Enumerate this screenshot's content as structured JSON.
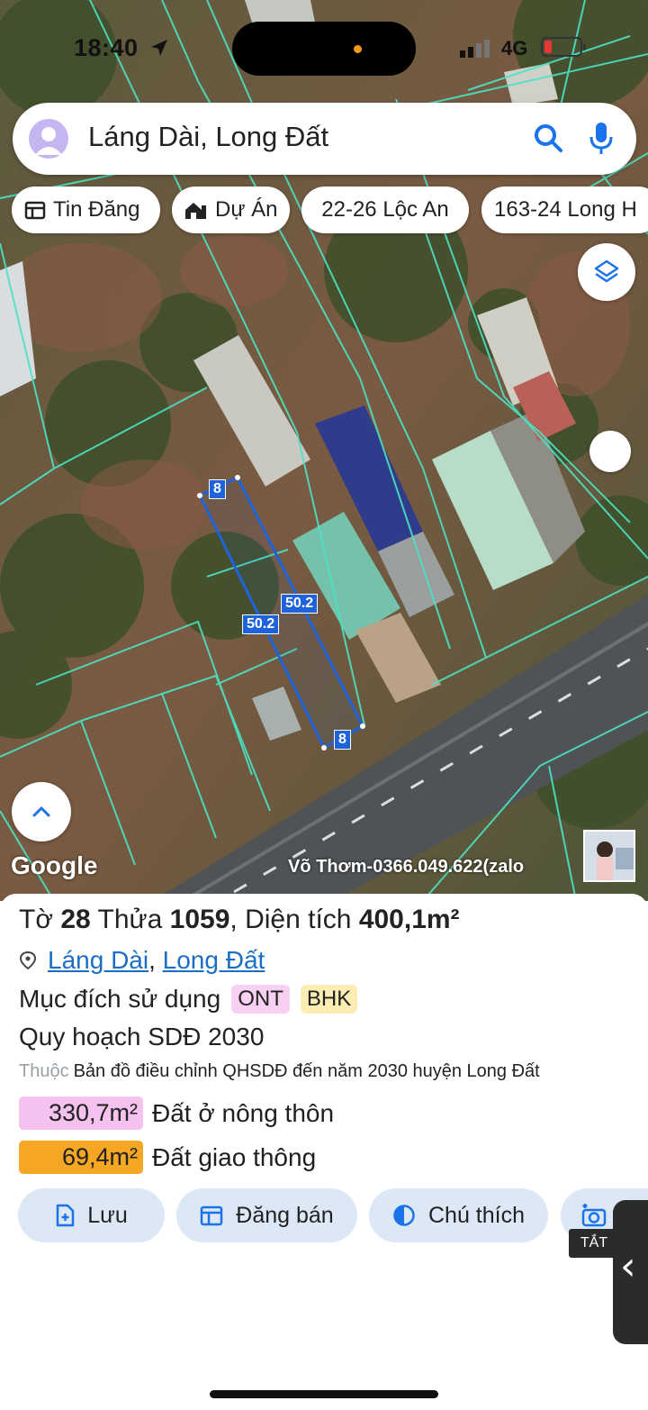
{
  "status_bar": {
    "time": "18:40",
    "network": "4G"
  },
  "search": {
    "query": "Láng Dài, Long Đất"
  },
  "chips": [
    {
      "label": "Tin Đăng",
      "icon": "listing-icon"
    },
    {
      "label": "Dự Án",
      "icon": "home-icon"
    },
    {
      "label": "22-26 Lộc An"
    },
    {
      "label": "163-24 Long H"
    }
  ],
  "map": {
    "attribution": "Google",
    "watermark": "Võ Thơm-0366.049.622(zalo",
    "measurements": {
      "side_a": "50.2",
      "side_b": "50.2",
      "top": "8",
      "bottom": "8"
    },
    "colors": {
      "parcel_outline": "#1e63d9",
      "cadastral_lines": "#4be3c4"
    }
  },
  "parcel": {
    "sheet_label": "Tờ",
    "sheet_number": "28",
    "plot_label": "Thửa",
    "plot_number": "1059",
    "area_label": "Diện tích",
    "area_value": "400,1m²",
    "ward": "Láng Dài",
    "district": "Long Đất",
    "land_use_label": "Mục đích sử dụng",
    "land_use_codes": [
      {
        "code": "ONT",
        "color": "#f7d0f2"
      },
      {
        "code": "BHK",
        "color": "#fbedb4"
      }
    ],
    "plan_title": "Quy hoạch SDĐ 2030",
    "source_label": "Thuộc",
    "source_value": "Bản đồ điều chỉnh QHSDĐ đến năm 2030 huyện Long Đất",
    "zones": [
      {
        "area": "330,7m²",
        "label": "Đất ở nông thôn",
        "color": "#f5c2f0"
      },
      {
        "area": "69,4m²",
        "label": "Đất giao thông",
        "color": "#f5a623"
      }
    ]
  },
  "actions": [
    {
      "label": "Lưu",
      "icon": "save-doc-icon"
    },
    {
      "label": "Đăng bán",
      "icon": "calendar-post-icon"
    },
    {
      "label": "Chú thích",
      "icon": "contrast-icon"
    },
    {
      "label": "",
      "icon": "camera-icon"
    }
  ],
  "tooltip": "TẮT"
}
